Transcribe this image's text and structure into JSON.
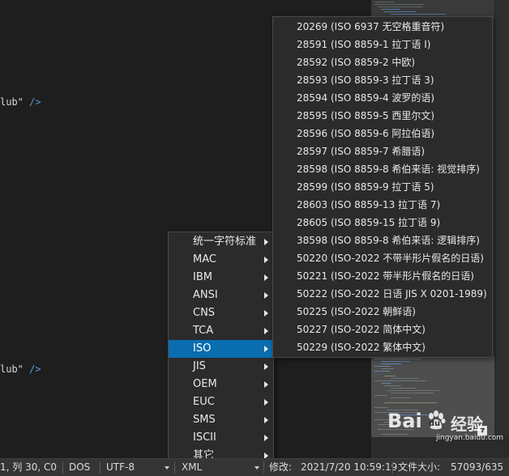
{
  "editor": {
    "lines": [
      {
        "text": "lub\" ",
        "slash": "/>"
      },
      {
        "text": "lub\" ",
        "slash": "/>"
      }
    ]
  },
  "encoding_menu": {
    "items": [
      {
        "label": "统一字符标准"
      },
      {
        "label": "MAC"
      },
      {
        "label": "IBM"
      },
      {
        "label": "ANSI"
      },
      {
        "label": "CNS"
      },
      {
        "label": "TCA"
      },
      {
        "label": "ISO",
        "active": true
      },
      {
        "label": "JIS"
      },
      {
        "label": "OEM"
      },
      {
        "label": "EUC"
      },
      {
        "label": "SMS"
      },
      {
        "label": "ISCII"
      },
      {
        "label": "其它"
      }
    ]
  },
  "iso_submenu": {
    "items": [
      "20269 (ISO 6937 无空格重音符)",
      "28591 (ISO 8859-1 拉丁语 I)",
      "28592 (ISO 8859-2 中欧)",
      "28593 (ISO 8859-3 拉丁语 3)",
      "28594 (ISO 8859-4 波罗的语)",
      "28595 (ISO 8859-5 西里尔文)",
      "28596 (ISO 8859-6 阿拉伯语)",
      "28597 (ISO 8859-7 希腊语)",
      "28598 (ISO 8859-8 希伯来语: 视觉排序)",
      "28599 (ISO 8859-9 拉丁语 5)",
      "28603 (ISO 8859-13 拉丁语 7)",
      "28605 (ISO 8859-15 拉丁语 9)",
      "38598 (ISO 8859-8 希伯来语: 逻辑排序)",
      "50220 (ISO-2022 不带半形片假名的日语)",
      "50221 (ISO-2022 带半形片假名的日语)",
      "50222 (ISO-2022 日语 JIS X 0201-1989)",
      "50225 (ISO-2022 朝鲜语)",
      "50227 (ISO-2022 简体中文)",
      "50229 (ISO-2022 繁体中文)"
    ]
  },
  "statusbar": {
    "position": "1, 列 30, C0",
    "line_ending": "DOS",
    "encoding": "UTF-8",
    "syntax": "XML",
    "modified_label": "修改:",
    "modified_value": "2021/7/20 10:59:19",
    "filesize_label": "文件大小:",
    "filesize_value": "57093/635"
  },
  "watermark": {
    "brand": "Bai",
    "brand2": "du",
    "suffix": "经验",
    "url": "jingyan.baidu.com"
  },
  "colors": {
    "menu_highlight": "#0a6db0",
    "menu_bg": "#2b2b2b",
    "editor_bg": "#1e1e1e",
    "xml_slash": "#569cd6"
  }
}
